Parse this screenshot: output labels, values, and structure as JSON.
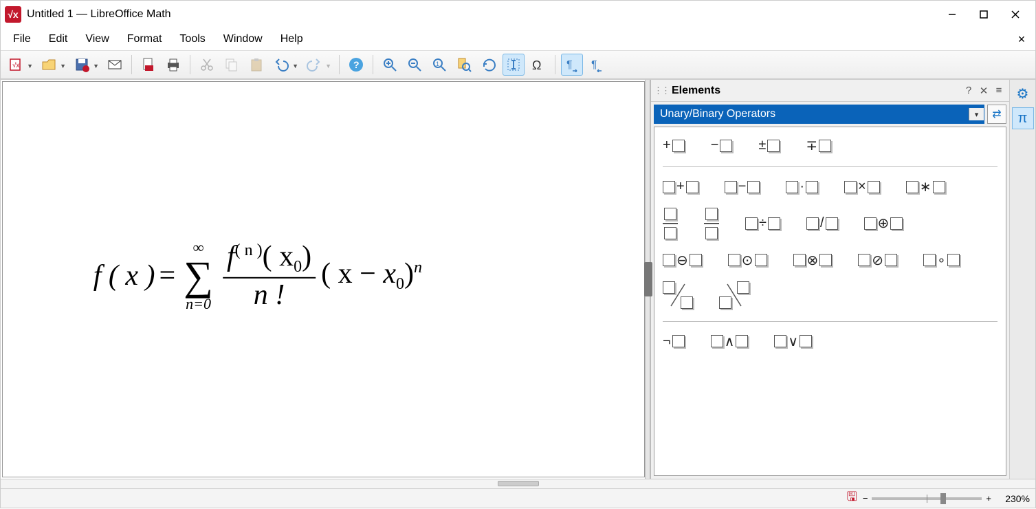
{
  "window": {
    "title": "Untitled 1 — LibreOffice Math"
  },
  "menu": [
    "File",
    "Edit",
    "View",
    "Format",
    "Tools",
    "Window",
    "Help"
  ],
  "toolbar": [
    {
      "name": "new",
      "drop": true
    },
    {
      "name": "open",
      "drop": true
    },
    {
      "name": "save",
      "drop": true
    },
    {
      "name": "mail"
    },
    {
      "sep": true
    },
    {
      "name": "export-pdf"
    },
    {
      "name": "print"
    },
    {
      "sep": true
    },
    {
      "name": "cut",
      "dim": true
    },
    {
      "name": "copy",
      "dim": true
    },
    {
      "name": "paste",
      "dim": true
    },
    {
      "name": "undo",
      "drop": true
    },
    {
      "name": "redo",
      "drop": true,
      "dim": true
    },
    {
      "sep": true
    },
    {
      "name": "help"
    },
    {
      "sep": true
    },
    {
      "name": "zoom-in"
    },
    {
      "name": "zoom-out"
    },
    {
      "name": "zoom-100"
    },
    {
      "name": "zoom-page"
    },
    {
      "name": "refresh"
    },
    {
      "name": "cursor",
      "active": true
    },
    {
      "name": "symbol"
    },
    {
      "sep": true
    },
    {
      "name": "pilcrow-ltr",
      "active": true
    },
    {
      "name": "pilcrow-rtl"
    }
  ],
  "formula": {
    "lhs": "f ( x )",
    "eq": "=",
    "sum_upper": "∞",
    "sum_lower": "n=0",
    "frac_num": "f",
    "frac_num_sup": "( n )",
    "frac_num_arg": "( x",
    "frac_num_arg_sub": "0",
    "frac_num_arg_close": ")",
    "frac_den": "n !",
    "tail_open": "( x −",
    "tail_x": "x",
    "tail_sub": "0",
    "tail_close": ")",
    "tail_sup": "n"
  },
  "elements_panel": {
    "title": "Elements",
    "category": "Unary/Binary Operators",
    "row1": [
      "+",
      "−",
      "±",
      "∓"
    ],
    "row2": [
      "+",
      "−",
      "·",
      "×",
      "∗"
    ],
    "row3_ops": [
      "÷",
      "/",
      "⊕"
    ],
    "row4": [
      "⊖",
      "⊙",
      "⊗",
      "⊘",
      "∘"
    ],
    "row6": [
      "¬",
      "∧",
      "∨"
    ]
  },
  "status": {
    "zoom": "230%"
  }
}
